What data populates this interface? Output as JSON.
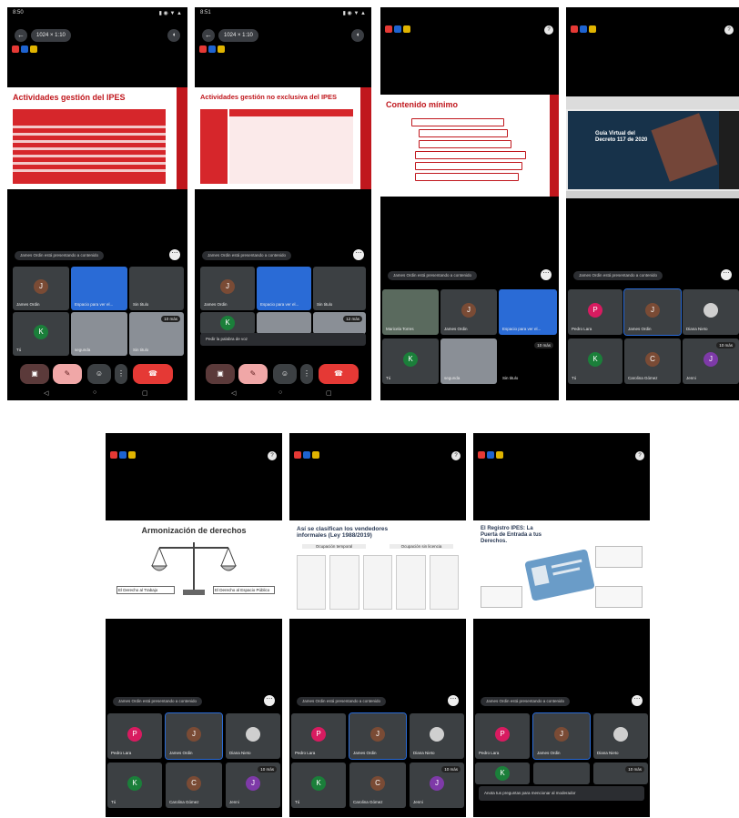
{
  "colors": {
    "red": "#c0171d",
    "blue": "#2a6bd6",
    "grey_tile": "#3c4043",
    "black": "#000000",
    "pink": "#d81b60",
    "green": "#1b7f3a",
    "brown": "#7a4b35",
    "purple": "#7e3aa8"
  },
  "phones": [
    {
      "status": {
        "time": "8:50",
        "icons": "▮ ◉ ▼ ▲"
      },
      "call_pill": "1024 × 1:10",
      "slide": {
        "title": "Actividades gestión del IPES"
      },
      "presenting_text": "James Ordin está presentando a contenido",
      "tiles": [
        {
          "name": "James Ordin",
          "initial": "J"
        },
        {
          "name": "Espacio para ver el..."
        },
        {
          "name": "Sin titulo"
        },
        {
          "name": "Tú",
          "initial": "K"
        },
        {
          "name": "segunda"
        },
        {
          "name": "Sin titulo",
          "badge": "10 más"
        }
      ]
    },
    {
      "status": {
        "time": "8:51",
        "icons": "▮ ◉ ▼ ▲"
      },
      "call_pill": "1024 × 1:10",
      "slide": {
        "title": "Actividades gestión no exclusiva del IPES"
      },
      "presenting_text": "James Ordin está presentando a contenido",
      "toast": "Pedir la palabra de voz",
      "tiles": [
        {
          "name": "James Ordin",
          "initial": "J"
        },
        {
          "name": "Espacio para ver el..."
        },
        {
          "name": "Sin titulo"
        },
        {
          "name": "Tú",
          "initial": "K"
        },
        {
          "name": "segunda"
        },
        {
          "name": "Sin titulo",
          "badge": "12 más"
        }
      ]
    },
    {
      "slide": {
        "title": "Contenido mínimo"
      },
      "presenting_text": "James Ordin está presentando a contenido",
      "tiles": [
        {
          "name": "Maricela Torres"
        },
        {
          "name": "James Ordin",
          "initial": "J"
        },
        {
          "name": "Espacio para ver el..."
        },
        {
          "name": "Tú",
          "initial": "K"
        },
        {
          "name": "segunda"
        },
        {
          "name": "Sin titulo",
          "badge": "10 más"
        }
      ]
    },
    {
      "slide": {
        "title": "Guía Virtual del Decreto 117 de 2020"
      },
      "presenting_text": "James Ordin está presentando a contenido",
      "tiles": [
        {
          "name": "Pedro Lara",
          "initial": "P"
        },
        {
          "name": "James Ordin",
          "initial": "J"
        },
        {
          "name": "Diana Nieto"
        },
        {
          "name": "Tú",
          "initial": "K"
        },
        {
          "name": "Carolina Gómez",
          "initial": "C"
        },
        {
          "name": "Jenni",
          "initial": "J",
          "badge": "10 más"
        }
      ]
    },
    {
      "slide": {
        "title": "Armonización de derechos",
        "left_caption": "El Derecho al Trabajo",
        "right_caption": "El Derecho al Espacio Público"
      },
      "presenting_text": "James Ordin está presentando a contenido",
      "tiles": [
        {
          "name": "Pedro Lara",
          "initial": "P"
        },
        {
          "name": "James Ordin",
          "initial": "J"
        },
        {
          "name": "Diana Nieto"
        },
        {
          "name": "Tú",
          "initial": "K"
        },
        {
          "name": "Carolina Gómez",
          "initial": "C"
        },
        {
          "name": "Jenni",
          "initial": "J",
          "badge": "10 más"
        }
      ]
    },
    {
      "slide": {
        "title": "Así se clasifican los vendedores informales (Ley 1988/2019)",
        "col1": "Ocupación temporal",
        "col2": "Ocupación sin licencia"
      },
      "presenting_text": "James Ordin está presentando a contenido",
      "tiles": [
        {
          "name": "Pedro Lara",
          "initial": "P"
        },
        {
          "name": "James Ordin",
          "initial": "J"
        },
        {
          "name": "Diana Nieto"
        },
        {
          "name": "Tú",
          "initial": "K"
        },
        {
          "name": "Carolina Gómez",
          "initial": "C"
        },
        {
          "name": "Jenni",
          "initial": "J",
          "badge": "10 más"
        }
      ]
    },
    {
      "slide": {
        "title": "El Registro IPES: La Puerta de Entrada a tus Derechos."
      },
      "presenting_text": "James Ordin está presentando a contenido",
      "toast": "Anota tus preguntas para mencionar al moderador",
      "tiles": [
        {
          "name": "Pedro Lara",
          "initial": "P"
        },
        {
          "name": "James Ordin",
          "initial": "J"
        },
        {
          "name": "Diana Nieto"
        },
        {
          "name": "Tú",
          "initial": "K"
        },
        {
          "name": "Carolina Gómez",
          "initial": "C"
        },
        {
          "name": "Jenni",
          "initial": "J",
          "badge": "10 más"
        }
      ]
    }
  ]
}
